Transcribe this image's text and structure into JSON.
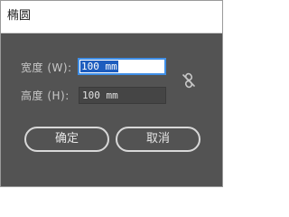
{
  "dialog": {
    "title": "椭圆"
  },
  "width": {
    "label": "宽度 (W):",
    "value": "100 mm"
  },
  "height": {
    "label": "高度 (H):",
    "value": "100 mm"
  },
  "link": {
    "icon": "unlinked-chain-icon"
  },
  "buttons": {
    "ok": "确定",
    "cancel": "取消"
  }
}
